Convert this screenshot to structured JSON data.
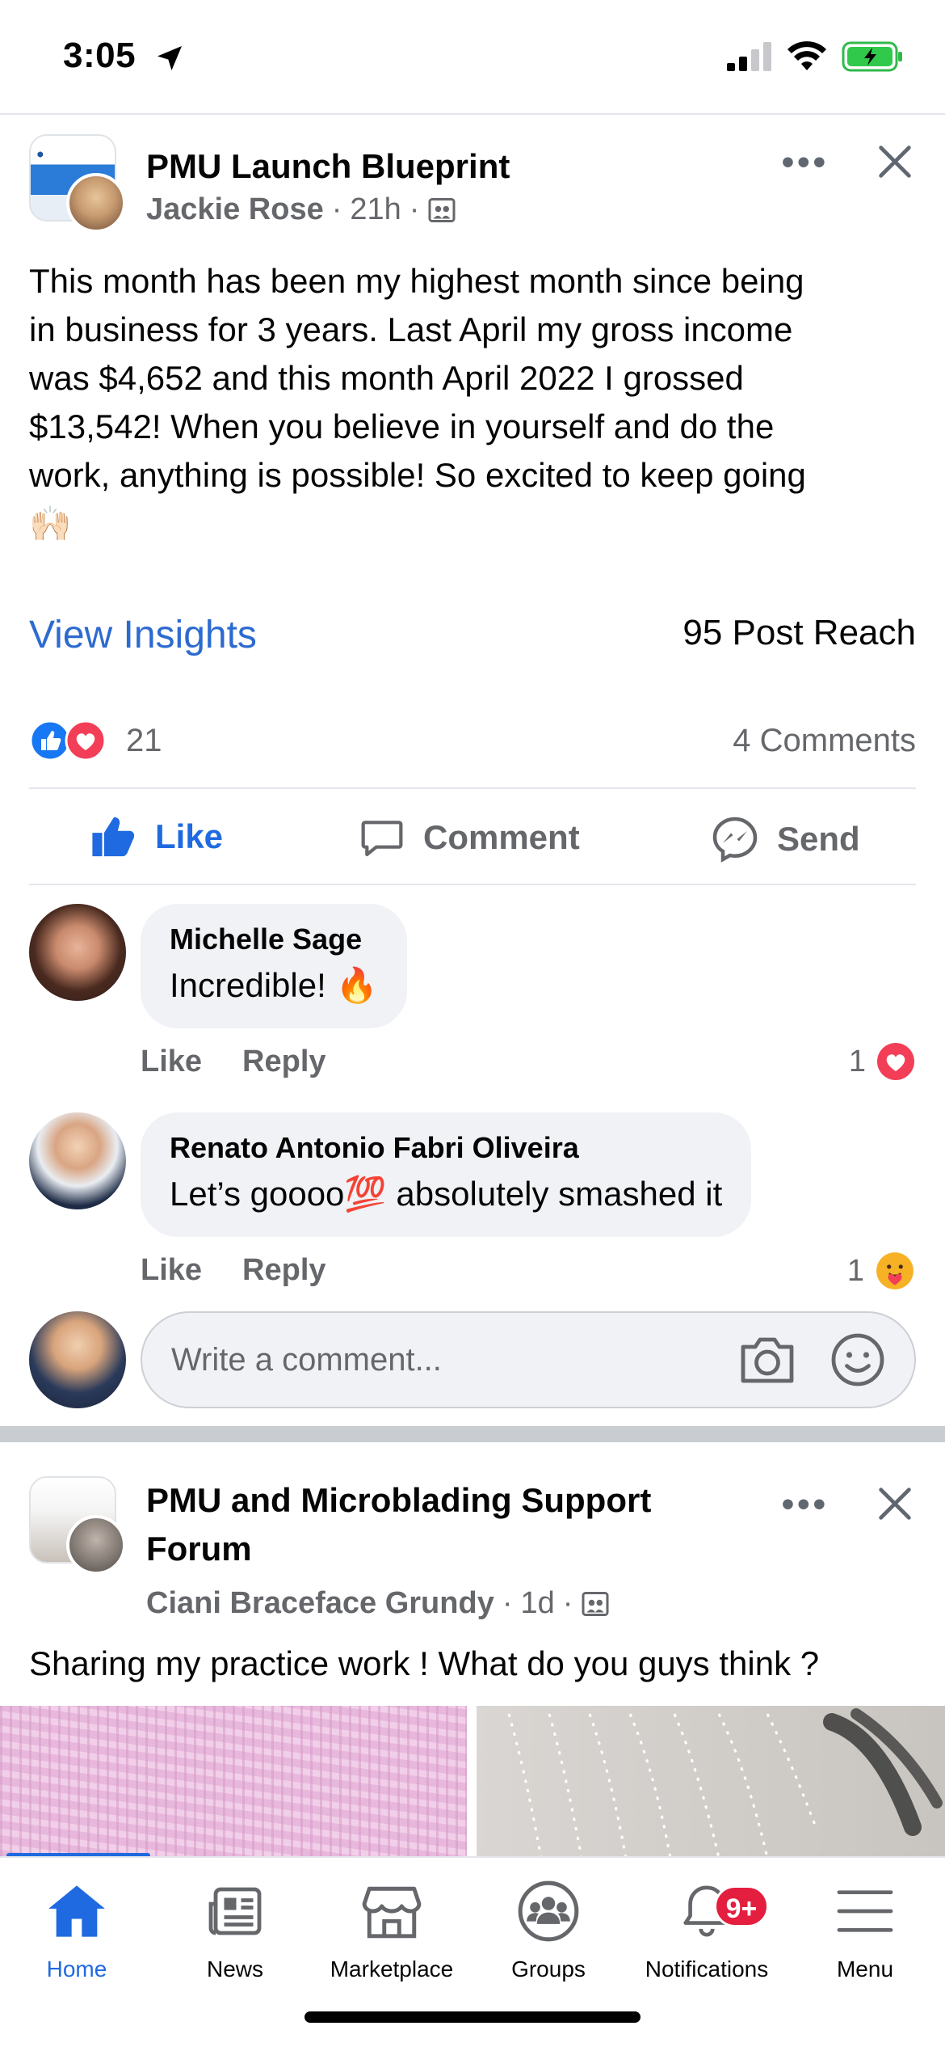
{
  "status": {
    "time": "3:05"
  },
  "post1": {
    "group_name": "PMU Launch Blueprint",
    "author": "Jackie Rose",
    "time": "21h",
    "text_lines": [
      "This month has been my highest month since being",
      "in business for 3 years. Last April my gross income",
      "was $4,652 and this month April 2022 I grossed",
      "$13,542! When you believe in yourself and do the",
      "work, anything is possible! So excited to keep going"
    ],
    "text_emoji": "🙌🏻",
    "view_insights": "View Insights",
    "post_reach": "95 Post Reach",
    "reaction_count": "21",
    "comment_count": "4 Comments",
    "actions": {
      "like": "Like",
      "comment": "Comment",
      "send": "Send"
    },
    "comments": [
      {
        "name": "Michelle Sage",
        "text": "Incredible! 🔥",
        "like": "Like",
        "reply": "Reply",
        "react_count": "1"
      },
      {
        "name": "Renato Antonio Fabri Oliveira",
        "text": "Let’s goooo💯 absolutely smashed it",
        "like": "Like",
        "reply": "Reply",
        "react_count": "1"
      }
    ],
    "write_placeholder": "Write a comment..."
  },
  "post2": {
    "group_name_line1": "PMU and Microblading Support",
    "group_name_line2": "Forum",
    "author": "Ciani Braceface Grundy",
    "time": "1d",
    "text": "Sharing my practice work ! What do you guys think ?"
  },
  "tabbar": {
    "tabs": [
      {
        "label": "Home",
        "icon": "home-icon"
      },
      {
        "label": "News",
        "icon": "news-icon"
      },
      {
        "label": "Marketplace",
        "icon": "marketplace-icon"
      },
      {
        "label": "Groups",
        "icon": "groups-icon"
      },
      {
        "label": "Notifications",
        "icon": "bell-icon"
      },
      {
        "label": "Menu",
        "icon": "menu-icon"
      }
    ],
    "notifications_badge": "9+"
  },
  "colors": {
    "accent": "#1f6ae0",
    "link": "#2d6ad0",
    "muted": "#65676b",
    "badge": "#e41e3f",
    "bubble": "#f0f2f5"
  }
}
